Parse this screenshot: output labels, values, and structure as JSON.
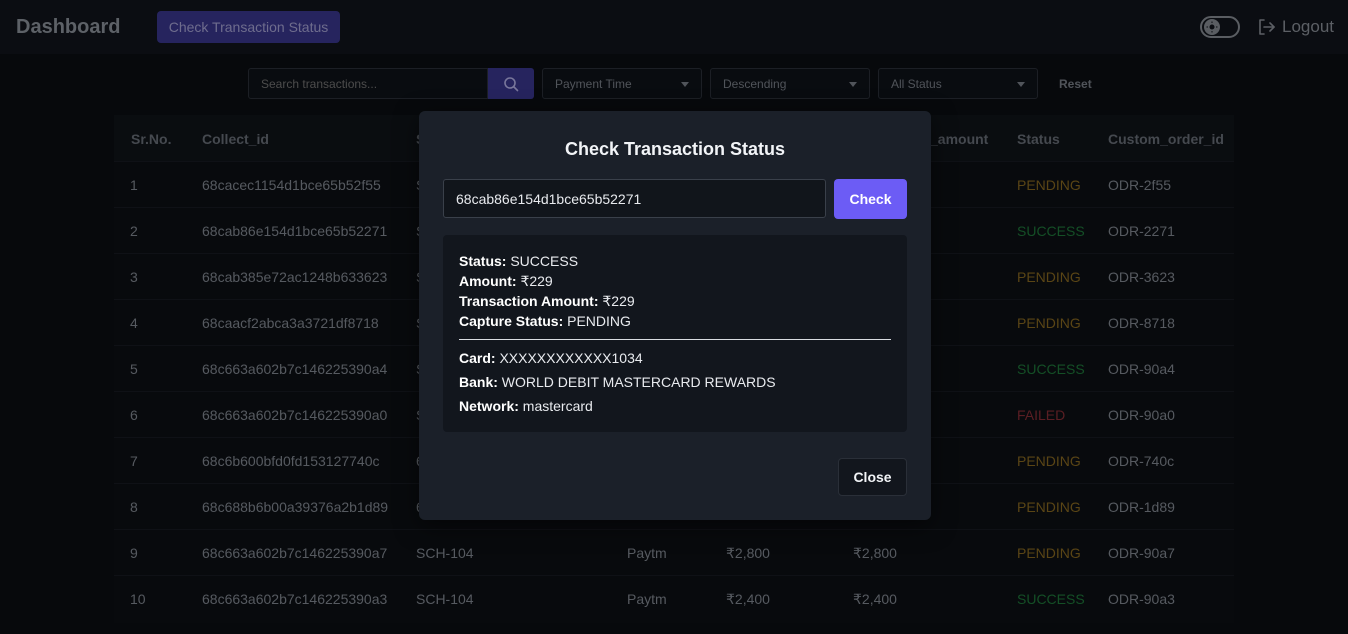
{
  "header": {
    "title": "Dashboard",
    "check_status_label": "Check Transaction Status",
    "logout_label": "Logout"
  },
  "filters": {
    "search_placeholder": "Search transactions...",
    "sort_field": "Payment Time",
    "sort_order": "Descending",
    "status_filter": "All Status",
    "reset_label": "Reset"
  },
  "table": {
    "columns": [
      "Sr.No.",
      "Collect_id",
      "S",
      "_amount",
      "Status",
      "Custom_order_id"
    ],
    "rows": [
      {
        "sr": "1",
        "collect_id": "68cacec1154d1bce65b52f55",
        "school": "S",
        "gateway": "",
        "order_amount": "",
        "txn_amount": "",
        "status": "PENDING",
        "custom_order_id": "ODR-2f55"
      },
      {
        "sr": "2",
        "collect_id": "68cab86e154d1bce65b52271",
        "school": "S",
        "gateway": "",
        "order_amount": "",
        "txn_amount": "",
        "status": "SUCCESS",
        "custom_order_id": "ODR-2271"
      },
      {
        "sr": "3",
        "collect_id": "68cab385e72ac1248b633623",
        "school": "S",
        "gateway": "",
        "order_amount": "",
        "txn_amount": "",
        "status": "PENDING",
        "custom_order_id": "ODR-3623"
      },
      {
        "sr": "4",
        "collect_id": "68caacf2abca3a3721df8718",
        "school": "S",
        "gateway": "",
        "order_amount": "",
        "txn_amount": "",
        "status": "PENDING",
        "custom_order_id": "ODR-8718"
      },
      {
        "sr": "5",
        "collect_id": "68c663a602b7c146225390a4",
        "school": "S",
        "gateway": "",
        "order_amount": "",
        "txn_amount": "",
        "status": "SUCCESS",
        "custom_order_id": "ODR-90a4"
      },
      {
        "sr": "6",
        "collect_id": "68c663a602b7c146225390a0",
        "school": "S",
        "gateway": "",
        "order_amount": "",
        "txn_amount": "",
        "status": "FAILED",
        "custom_order_id": "ODR-90a0"
      },
      {
        "sr": "7",
        "collect_id": "68c6b600bfd0fd153127740c",
        "school": "6",
        "gateway": "",
        "order_amount": "",
        "txn_amount": "",
        "status": "PENDING",
        "custom_order_id": "ODR-740c"
      },
      {
        "sr": "8",
        "collect_id": "68c688b6b00a39376a2b1d89",
        "school": "6",
        "gateway": "",
        "order_amount": "",
        "txn_amount": "",
        "status": "PENDING",
        "custom_order_id": "ODR-1d89"
      },
      {
        "sr": "9",
        "collect_id": "68c663a602b7c146225390a7",
        "school": "SCH-104",
        "gateway": "Paytm",
        "order_amount": "₹2,800",
        "txn_amount": "₹2,800",
        "status": "PENDING",
        "custom_order_id": "ODR-90a7"
      },
      {
        "sr": "10",
        "collect_id": "68c663a602b7c146225390a3",
        "school": "SCH-104",
        "gateway": "Paytm",
        "order_amount": "₹2,400",
        "txn_amount": "₹2,400",
        "status": "SUCCESS",
        "custom_order_id": "ODR-90a3"
      }
    ]
  },
  "modal": {
    "title": "Check Transaction Status",
    "input_value": "68cab86e154d1bce65b52271",
    "check_label": "Check",
    "close_label": "Close",
    "result": {
      "status_label": "Status:",
      "status_value": "SUCCESS",
      "amount_label": "Amount:",
      "amount_value": "₹229",
      "txn_amount_label": "Transaction Amount:",
      "txn_amount_value": "₹229",
      "capture_label": "Capture Status:",
      "capture_value": "PENDING",
      "card_label": "Card:",
      "card_value": "XXXXXXXXXXXX1034",
      "bank_label": "Bank:",
      "bank_value": "WORLD DEBIT MASTERCARD REWARDS",
      "network_label": "Network:",
      "network_value": "mastercard"
    }
  }
}
